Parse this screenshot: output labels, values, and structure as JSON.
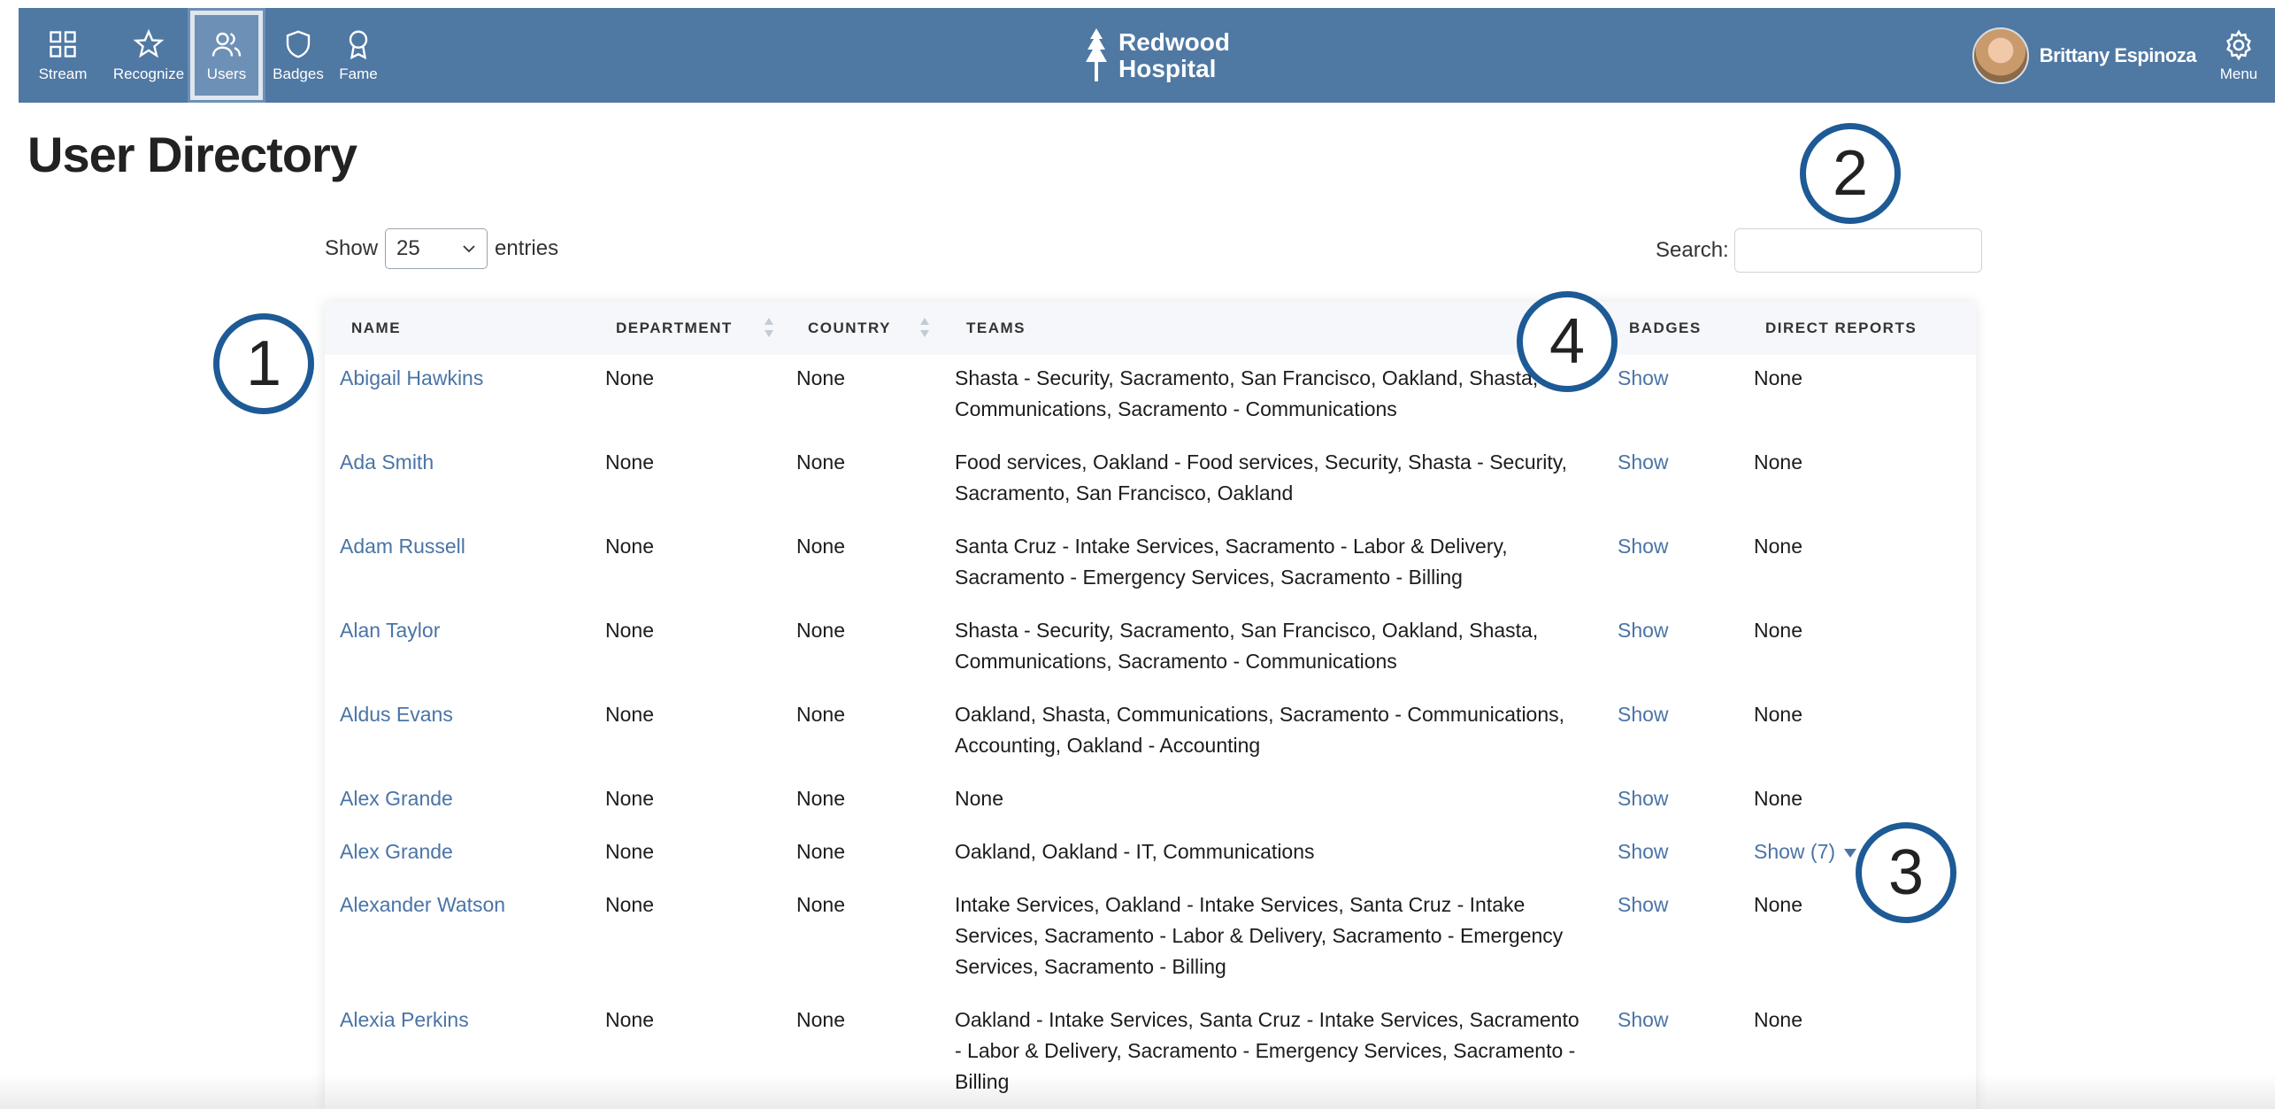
{
  "nav": {
    "items": [
      {
        "label": "Stream",
        "icon": "grid-icon"
      },
      {
        "label": "Recognize",
        "icon": "star-icon"
      },
      {
        "label": "Users",
        "icon": "users-icon"
      },
      {
        "label": "Badges",
        "icon": "shield-icon"
      },
      {
        "label": "Fame",
        "icon": "ribbon-icon"
      }
    ],
    "active": "Users"
  },
  "brand": {
    "line1": "Redwood",
    "line2": "Hospital"
  },
  "user": {
    "name": "Brittany Espinoza"
  },
  "menu": {
    "label": "Menu"
  },
  "page": {
    "title": "User Directory"
  },
  "controls": {
    "show_label": "Show",
    "entries_value": "25",
    "entries_label": "entries",
    "search_label": "Search:",
    "search_value": ""
  },
  "table": {
    "headers": {
      "name": "NAME",
      "department": "DEPARTMENT",
      "country": "COUNTRY",
      "teams": "TEAMS",
      "badges": "BADGES",
      "direct_reports": "DIRECT REPORTS"
    },
    "rows": [
      {
        "name": "Abigail Hawkins",
        "department": "None",
        "country": "None",
        "teams": "Shasta - Security, Sacramento, San Francisco, Oakland, Shasta, Communications, Sacramento - Communications",
        "badges": "Show",
        "direct_reports": "None"
      },
      {
        "name": "Ada Smith",
        "department": "None",
        "country": "None",
        "teams": "Food services, Oakland - Food services, Security, Shasta - Security, Sacramento, San Francisco, Oakland",
        "badges": "Show",
        "direct_reports": "None"
      },
      {
        "name": "Adam Russell",
        "department": "None",
        "country": "None",
        "teams": "Santa Cruz - Intake Services, Sacramento - Labor & Delivery, Sacramento - Emergency Services, Sacramento - Billing",
        "badges": "Show",
        "direct_reports": "None"
      },
      {
        "name": "Alan Taylor",
        "department": "None",
        "country": "None",
        "teams": "Shasta - Security, Sacramento, San Francisco, Oakland, Shasta, Communications, Sacramento - Communications",
        "badges": "Show",
        "direct_reports": "None"
      },
      {
        "name": "Aldus Evans",
        "department": "None",
        "country": "None",
        "teams": "Oakland, Shasta, Communications, Sacramento - Communications, Accounting, Oakland - Accounting",
        "badges": "Show",
        "direct_reports": "None"
      },
      {
        "name": "Alex Grande",
        "department": "None",
        "country": "None",
        "teams": "None",
        "badges": "Show",
        "direct_reports": "None"
      },
      {
        "name": "Alex Grande",
        "department": "None",
        "country": "None",
        "teams": "Oakland, Oakland - IT, Communications",
        "badges": "Show",
        "direct_reports": "Show (7)"
      },
      {
        "name": "Alexander Watson",
        "department": "None",
        "country": "None",
        "teams": "Intake Services, Oakland - Intake Services, Santa Cruz - Intake Services, Sacramento - Labor & Delivery, Sacramento - Emergency Services, Sacramento - Billing",
        "badges": "Show",
        "direct_reports": "None"
      },
      {
        "name": "Alexia Perkins",
        "department": "None",
        "country": "None",
        "teams": "Oakland - Intake Services, Santa Cruz - Intake Services, Sacramento - Labor & Delivery, Sacramento - Emergency Services, Sacramento - Billing",
        "badges": "Show",
        "direct_reports": "None"
      }
    ]
  },
  "callouts": [
    "1",
    "2",
    "3",
    "4"
  ],
  "colors": {
    "header_bg": "#4f78a3",
    "link": "#4a74a6",
    "callout_ring": "#1d5a96"
  }
}
